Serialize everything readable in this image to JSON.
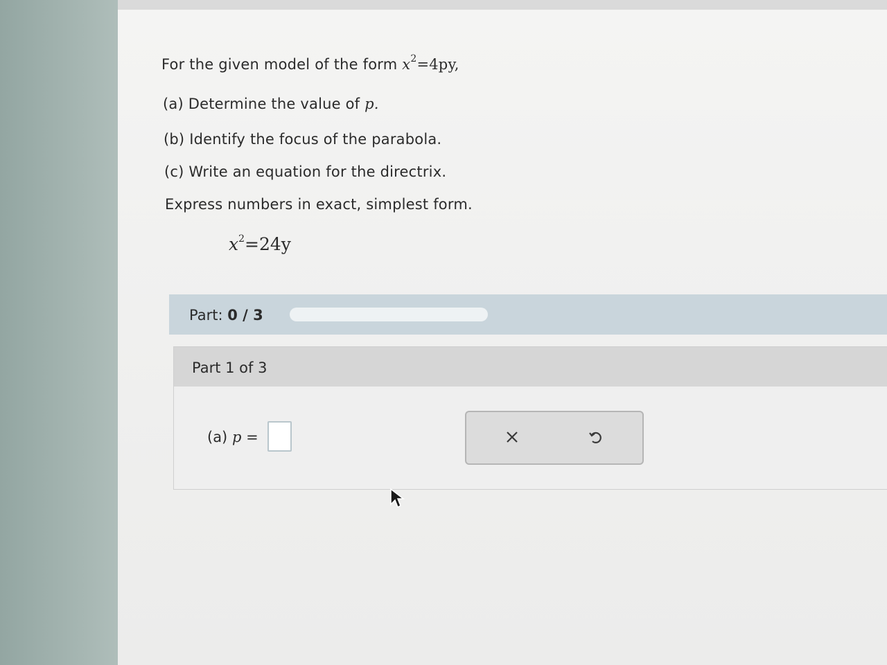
{
  "question": {
    "intro_text": "For the given model of the form",
    "intro_formula": {
      "base": "x",
      "exponent": "2",
      "rest": "=4py,"
    },
    "part_a": "(a) Determine the value of",
    "part_a_var": "p.",
    "part_b": "(b) Identify the focus of the parabola.",
    "part_c": "(c) Write an equation for the directrix.",
    "instruction": "Express numbers in exact, simplest form.",
    "equation": {
      "base": "x",
      "exponent": "2",
      "rest": "=24y"
    }
  },
  "progress": {
    "label": "Part:",
    "value": "0 / 3",
    "fraction": 0
  },
  "section": {
    "title": "Part 1 of 3",
    "answer_prefix": "(a)",
    "answer_var": "p",
    "answer_equals": "=",
    "answer_value": ""
  },
  "tools": {
    "clear_icon": "close-icon",
    "undo_icon": "undo-icon"
  },
  "colors": {
    "progress_bar_bg": "#c9d5dc",
    "section_header_bg": "#d6d6d6"
  }
}
